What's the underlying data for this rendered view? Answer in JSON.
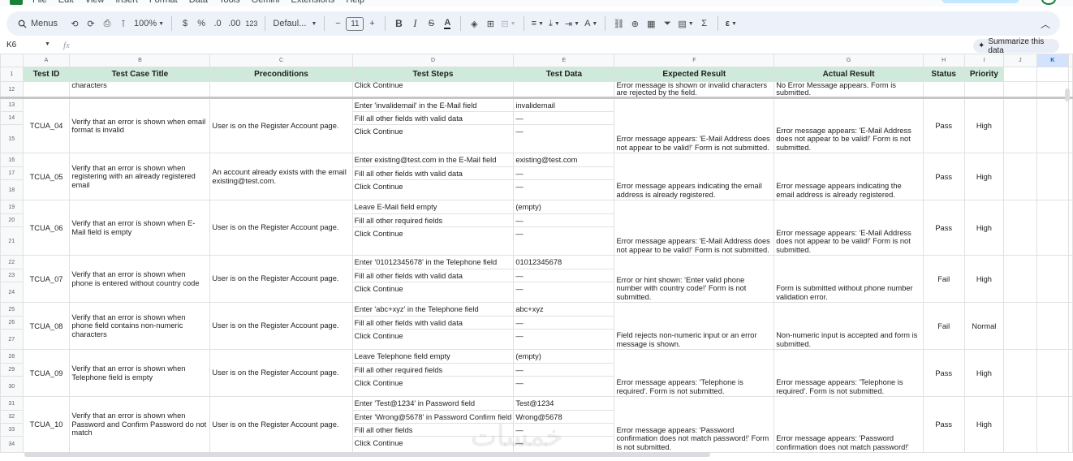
{
  "menubar": {
    "items": [
      "File",
      "Edit",
      "View",
      "Insert",
      "Format",
      "Data",
      "Tools",
      "Gemini",
      "Extensions",
      "Help"
    ]
  },
  "toolbar": {
    "menus_label": "Menus",
    "zoom": "100%",
    "currency": "$",
    "percent": "%",
    "decrease_decimal": ".0",
    "increase_decimal": ".00",
    "number_format": "123",
    "font": "Defaul...",
    "font_size": "11",
    "bold": "B",
    "italic": "I",
    "strike": "S",
    "text_color": "A",
    "sigma": "Σ"
  },
  "formula_bar": {
    "cell_ref": "K6",
    "fx": "fx",
    "summarize_label": "Summarize this data"
  },
  "columns": [
    {
      "letter": "A"
    },
    {
      "letter": "B"
    },
    {
      "letter": "C"
    },
    {
      "letter": "D"
    },
    {
      "letter": "E"
    },
    {
      "letter": "F"
    },
    {
      "letter": "G"
    },
    {
      "letter": "H"
    },
    {
      "letter": "I"
    },
    {
      "letter": "J"
    },
    {
      "letter": "K"
    }
  ],
  "header_row": {
    "row": "1",
    "cells": [
      "Test ID",
      "Test Case Title",
      "Preconditions",
      "Test Steps",
      "Test Data",
      "Expected Result",
      "Actual Result",
      "Status",
      "Priority",
      "",
      ""
    ]
  },
  "partial_row": {
    "row": "12",
    "b": "characters",
    "d": "Click Continue",
    "f": "Error message is shown or invalid characters are rejected by the field.",
    "g": "No Error Message appears. Form is submitted."
  },
  "test_cases": [
    {
      "id": "TCUA_04",
      "title": "Verify that an error is shown when email format is invalid",
      "precondition": "User is on the Register Account page.",
      "rows": [
        "13",
        "14",
        "15"
      ],
      "steps": [
        "Enter 'invalidemail' in the E-Mail field",
        "Fill all other fields with valid data",
        "Click Continue"
      ],
      "data": [
        "invalidemail",
        "—",
        "—"
      ],
      "expected": "Error message appears: 'E-Mail Address does not appear to be valid!' Form is not submitted.",
      "actual": "Error message appears: 'E-Mail Address does not appear to be valid!' Form is not submitted.",
      "status": "Pass",
      "priority": "High"
    },
    {
      "id": "TCUA_05",
      "title": "Verify that an error is shown when registering with an already registered email",
      "precondition": "An account already exists with the email existing@test.com.",
      "rows": [
        "16",
        "17",
        "18"
      ],
      "steps": [
        "Enter existing@test.com in the E-Mail field",
        "Fill all other fields with valid data",
        "Click Continue"
      ],
      "data": [
        "existing@test.com",
        "—",
        "—"
      ],
      "expected": "Error message appears indicating the email address is already registered.",
      "actual": "Error message appears indicating the email address is already registered.",
      "status": "Pass",
      "priority": "High"
    },
    {
      "id": "TCUA_06",
      "title": "Verify that an error is shown when E-Mail field is empty",
      "precondition": "User is on the Register Account page.",
      "rows": [
        "19",
        "20",
        "21"
      ],
      "steps": [
        "Leave E-Mail field empty",
        "Fill all other required fields",
        "Click Continue"
      ],
      "data": [
        "(empty)",
        "—",
        "—"
      ],
      "expected": "Error message appears: 'E-Mail Address does not appear to be valid!' Form is not submitted.",
      "actual": "Error message appears: 'E-Mail Address does not appear to be valid!' Form is not submitted.",
      "status": "Pass",
      "priority": "High"
    },
    {
      "id": "TCUA_07",
      "title": "Verify that an error is shown when phone is entered without country code",
      "precondition": "User is on the Register Account page.",
      "rows": [
        "22",
        "23",
        "24"
      ],
      "steps": [
        "Enter '01012345678' in the Telephone field",
        "Fill all other fields with valid data",
        "Click Continue"
      ],
      "data": [
        "01012345678",
        "—",
        "—"
      ],
      "expected": "Error or hint shown: 'Enter valid phone number with country code!' Form is not submitted.",
      "actual": "Form is submitted without phone number validation error.",
      "status": "Fail",
      "priority": "High"
    },
    {
      "id": "TCUA_08",
      "title": "Verify that an error is shown when phone field contains non-numeric characters",
      "precondition": "User is on the Register Account page.",
      "rows": [
        "25",
        "26",
        "27"
      ],
      "steps": [
        "Enter 'abc+xyz' in the Telephone field",
        "Fill all other fields with valid data",
        "Click Continue"
      ],
      "data": [
        "abc+xyz",
        "—",
        "—"
      ],
      "expected": "Field rejects non-numeric input or an error message is shown.",
      "actual": "Non-numeric input is accepted and form is submitted.",
      "status": "Fail",
      "priority": "Normal"
    },
    {
      "id": "TCUA_09",
      "title": "Verify that an error is shown when Telephone field is empty",
      "precondition": "User is on the Register Account page.",
      "rows": [
        "28",
        "29",
        "30"
      ],
      "steps": [
        "Leave Telephone field empty",
        "Fill all other required fields",
        "Click Continue"
      ],
      "data": [
        "(empty)",
        "—",
        "—"
      ],
      "expected": "Error message appears: 'Telephone is required'. Form is not submitted.",
      "actual": "Error message appears: 'Telephone is required'. Form is not submitted.",
      "status": "Pass",
      "priority": "High"
    },
    {
      "id": "TCUA_10",
      "title": "Verify that an error is shown when Password and Confirm Password do not match",
      "precondition": "User is on the Register Account page.",
      "rows": [
        "31",
        "32",
        "33",
        "34"
      ],
      "steps": [
        "Enter 'Test@1234' in Password field",
        "Enter 'Wrong@5678' in Password Confirm field",
        "Fill all other fields",
        "Click Continue"
      ],
      "data": [
        "Test@1234",
        "Wrong@5678",
        "—",
        "—"
      ],
      "expected": "Error message appears: 'Password confirmation does not match password!' Form is not submitted.",
      "actual": "Error message appears: 'Password confirmation does not match password!'",
      "status": "Pass",
      "priority": "High"
    }
  ],
  "watermark": "خمسات"
}
